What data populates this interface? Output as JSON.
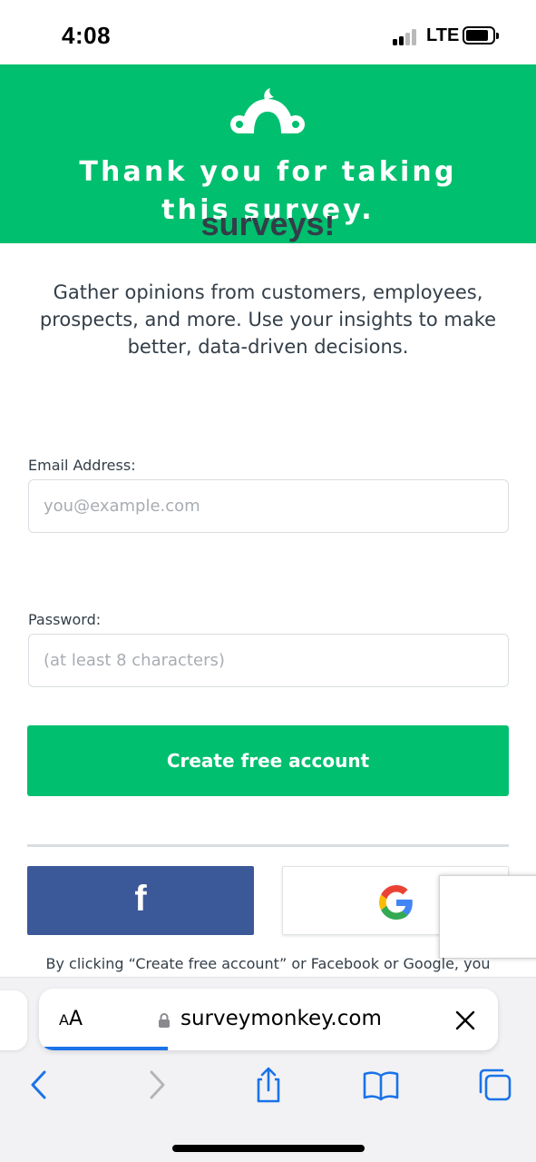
{
  "status_bar": {
    "time": "4:08",
    "network": "LTE"
  },
  "banner": {
    "logo_icon": "surveymonkey-logo-icon",
    "title_line1": "Thank you for taking",
    "title_line2": "this survey."
  },
  "main": {
    "partial_heading": "surveys!",
    "intro_line1": "Gather opinions from customers, employees,",
    "intro_line2": "prospects, and more. Use your insights to make",
    "intro_line3": "better, data-driven decisions.",
    "email": {
      "label": "Email Address:",
      "value": "",
      "placeholder": "you@example.com"
    },
    "password": {
      "label": "Password:",
      "value": "",
      "placeholder": "(at least 8 characters)"
    },
    "create_button": "Create free account",
    "facebook_glyph": "f",
    "legal_text": "By clicking “Create free account” or Facebook or Google, you"
  },
  "browser": {
    "text_size_small": "A",
    "text_size_big": "A",
    "url": "surveymonkey.com",
    "page_load_progress": 0.28
  },
  "colors": {
    "brand_green": "#00bf6f",
    "facebook_blue": "#3b5998",
    "text_dark": "#333e48",
    "ios_blue": "#1a73e8"
  }
}
